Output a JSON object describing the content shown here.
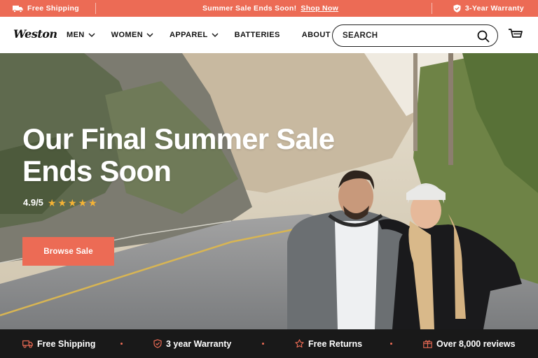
{
  "colors": {
    "accent": "#ec6b55",
    "star": "#f5b335",
    "dark_bar": "#191919"
  },
  "announcement": {
    "left": {
      "icon": "truck-icon",
      "text": "Free Shipping"
    },
    "center": {
      "text": "Summer Sale Ends Soon!",
      "link": "Shop Now"
    },
    "right": {
      "icon": "shield-check-icon",
      "text": "3-Year Warranty"
    }
  },
  "header": {
    "logo": "Weston",
    "nav": [
      {
        "label": "MEN",
        "dropdown": true
      },
      {
        "label": "WOMEN",
        "dropdown": true
      },
      {
        "label": "APPAREL",
        "dropdown": true
      },
      {
        "label": "BATTERIES",
        "dropdown": false
      },
      {
        "label": "ABOUT",
        "dropdown": true
      }
    ],
    "search": {
      "placeholder": "SEARCH",
      "value": "",
      "icon": "search-icon"
    },
    "cart_icon": "cart-icon"
  },
  "hero": {
    "title": "Our Final Summer Sale Ends Soon",
    "rating": "4.9/5",
    "stars": 5,
    "cta": "Browse Sale"
  },
  "benefits": [
    {
      "icon": "truck-icon",
      "text": "Free Shipping"
    },
    {
      "icon": "shield-check-icon",
      "text": "3 year Warranty"
    },
    {
      "icon": "star-outline-icon",
      "text": "Free Returns"
    },
    {
      "icon": "gift-box-icon",
      "text": "Over 8,000 reviews"
    }
  ]
}
